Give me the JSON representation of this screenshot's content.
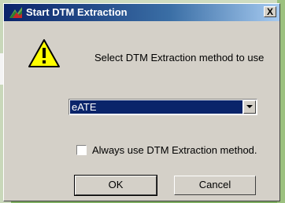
{
  "dialog": {
    "title": "Start DTM Extraction",
    "close_glyph": "X",
    "icons": {
      "app": "dtm-app-icon",
      "warning": "warning-icon",
      "close": "close-icon"
    },
    "prompt": "Select DTM Extraction method to use",
    "method_select": {
      "selected": "eATE"
    },
    "always_use": {
      "label": "Always use DTM Extraction method.",
      "checked": false
    },
    "buttons": {
      "ok": "OK",
      "cancel": "Cancel"
    }
  }
}
